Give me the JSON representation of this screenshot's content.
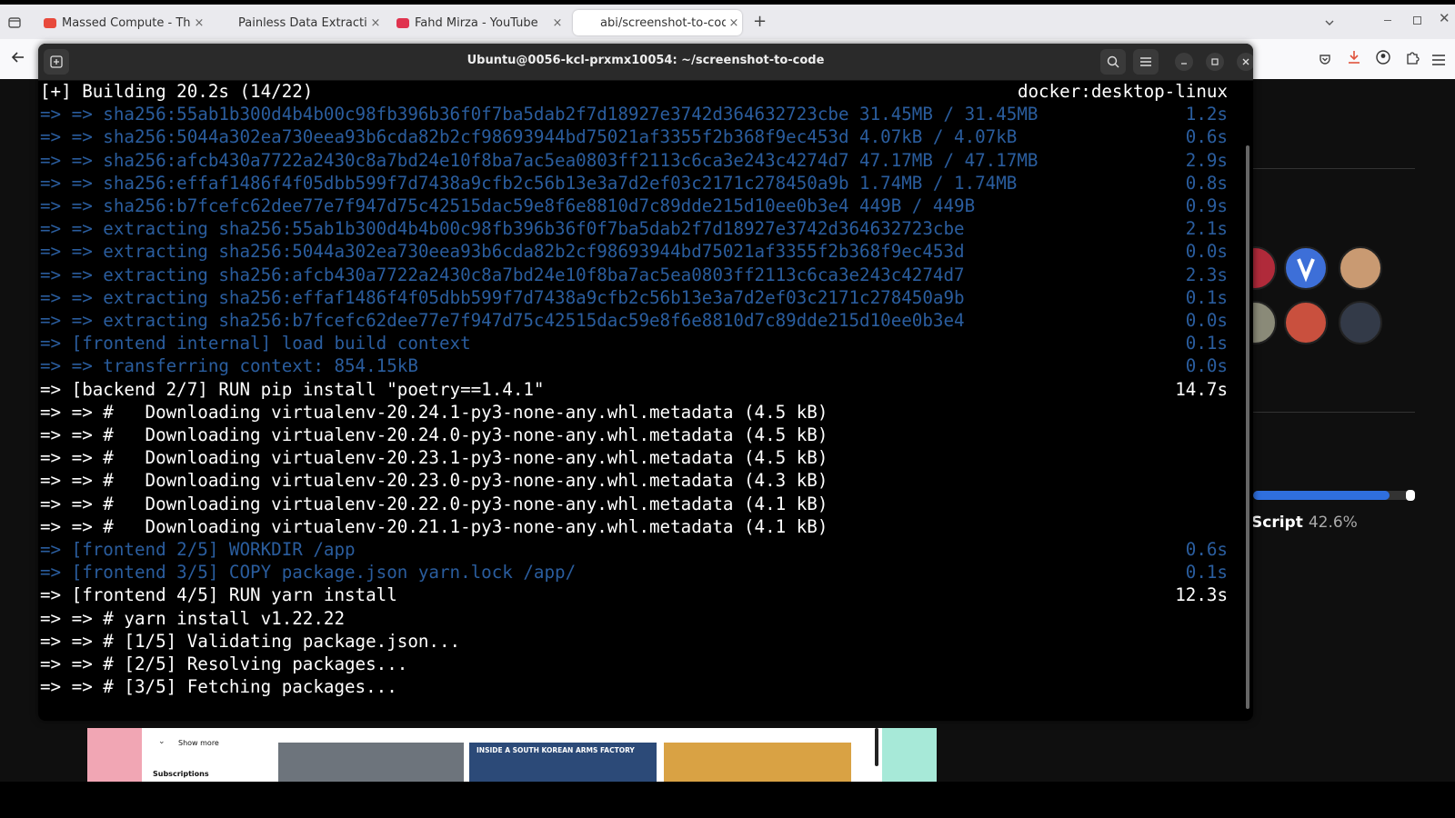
{
  "browser": {
    "tabs": [
      {
        "title": "Massed Compute - Think",
        "favicon_color": "#e84a3c",
        "active": false
      },
      {
        "title": "Painless Data Extraction",
        "favicon_color": "",
        "active": false
      },
      {
        "title": "Fahd Mirza - YouTube",
        "favicon_color": "#e0334f",
        "active": false
      },
      {
        "title": "abi/screenshot-to-code:",
        "favicon_color": "",
        "active": true
      }
    ],
    "new_tab_label": "+",
    "close_label": "×"
  },
  "side": {
    "language_name": "Script",
    "language_percent": "42.6%",
    "language_fraction": 0.85
  },
  "thumbs": {
    "show_more": "Show more",
    "subscriptions": "Subscriptions",
    "video_title": "INSIDE A SOUTH KOREAN ARMS FACTORY"
  },
  "terminal": {
    "title": "Ubuntu@0056-kcl-prxmx10054: ~/screenshot-to-code",
    "header": "[+] Building 20.2s (14/22)",
    "header_right": "docker:desktop-linux",
    "lines": [
      {
        "text": "=> => sha256:55ab1b300d4b4b00c98fb396b36f0f7ba5dab2f7d18927e3742d364632723cbe 31.45MB / 31.45MB",
        "time": "1.2s",
        "dim": true
      },
      {
        "text": "=> => sha256:5044a302ea730eea93b6cda82b2cf98693944bd75021af3355f2b368f9ec453d 4.07kB / 4.07kB",
        "time": "0.6s",
        "dim": true
      },
      {
        "text": "=> => sha256:afcb430a7722a2430c8a7bd24e10f8ba7ac5ea0803ff2113c6ca3e243c4274d7 47.17MB / 47.17MB",
        "time": "2.9s",
        "dim": true
      },
      {
        "text": "=> => sha256:effaf1486f4f05dbb599f7d7438a9cfb2c56b13e3a7d2ef03c2171c278450a9b 1.74MB / 1.74MB",
        "time": "0.8s",
        "dim": true
      },
      {
        "text": "=> => sha256:b7fcefc62dee77e7f947d75c42515dac59e8f6e8810d7c89dde215d10ee0b3e4 449B / 449B",
        "time": "0.9s",
        "dim": true
      },
      {
        "text": "=> => extracting sha256:55ab1b300d4b4b00c98fb396b36f0f7ba5dab2f7d18927e3742d364632723cbe",
        "time": "2.1s",
        "dim": true
      },
      {
        "text": "=> => extracting sha256:5044a302ea730eea93b6cda82b2cf98693944bd75021af3355f2b368f9ec453d",
        "time": "0.0s",
        "dim": true
      },
      {
        "text": "=> => extracting sha256:afcb430a7722a2430c8a7bd24e10f8ba7ac5ea0803ff2113c6ca3e243c4274d7",
        "time": "2.3s",
        "dim": true
      },
      {
        "text": "=> => extracting sha256:effaf1486f4f05dbb599f7d7438a9cfb2c56b13e3a7d2ef03c2171c278450a9b",
        "time": "0.1s",
        "dim": true
      },
      {
        "text": "=> => extracting sha256:b7fcefc62dee77e7f947d75c42515dac59e8f6e8810d7c89dde215d10ee0b3e4",
        "time": "0.0s",
        "dim": true
      },
      {
        "text": "=> [frontend internal] load build context",
        "time": "0.1s",
        "dim": true
      },
      {
        "text": "=> => transferring context: 854.15kB",
        "time": "0.0s",
        "dim": true
      },
      {
        "text": "=> [backend 2/7] RUN pip install \"poetry==1.4.1\"",
        "time": "14.7s",
        "dim": false
      },
      {
        "text": "=> => #   Downloading virtualenv-20.24.1-py3-none-any.whl.metadata (4.5 kB)",
        "time": "",
        "dim": false
      },
      {
        "text": "=> => #   Downloading virtualenv-20.24.0-py3-none-any.whl.metadata (4.5 kB)",
        "time": "",
        "dim": false
      },
      {
        "text": "=> => #   Downloading virtualenv-20.23.1-py3-none-any.whl.metadata (4.5 kB)",
        "time": "",
        "dim": false
      },
      {
        "text": "=> => #   Downloading virtualenv-20.23.0-py3-none-any.whl.metadata (4.3 kB)",
        "time": "",
        "dim": false
      },
      {
        "text": "=> => #   Downloading virtualenv-20.22.0-py3-none-any.whl.metadata (4.1 kB)",
        "time": "",
        "dim": false
      },
      {
        "text": "=> => #   Downloading virtualenv-20.21.1-py3-none-any.whl.metadata (4.1 kB)",
        "time": "",
        "dim": false
      },
      {
        "text": "=> [frontend 2/5] WORKDIR /app",
        "time": "0.6s",
        "dim": true
      },
      {
        "text": "=> [frontend 3/5] COPY package.json yarn.lock /app/",
        "time": "0.1s",
        "dim": true
      },
      {
        "text": "=> [frontend 4/5] RUN yarn install",
        "time": "12.3s",
        "dim": false
      },
      {
        "text": "=> => # yarn install v1.22.22",
        "time": "",
        "dim": false
      },
      {
        "text": "=> => # [1/5] Validating package.json...",
        "time": "",
        "dim": false
      },
      {
        "text": "=> => # [2/5] Resolving packages...",
        "time": "",
        "dim": false
      },
      {
        "text": "=> => # [3/5] Fetching packages...",
        "time": "",
        "dim": false
      }
    ]
  }
}
